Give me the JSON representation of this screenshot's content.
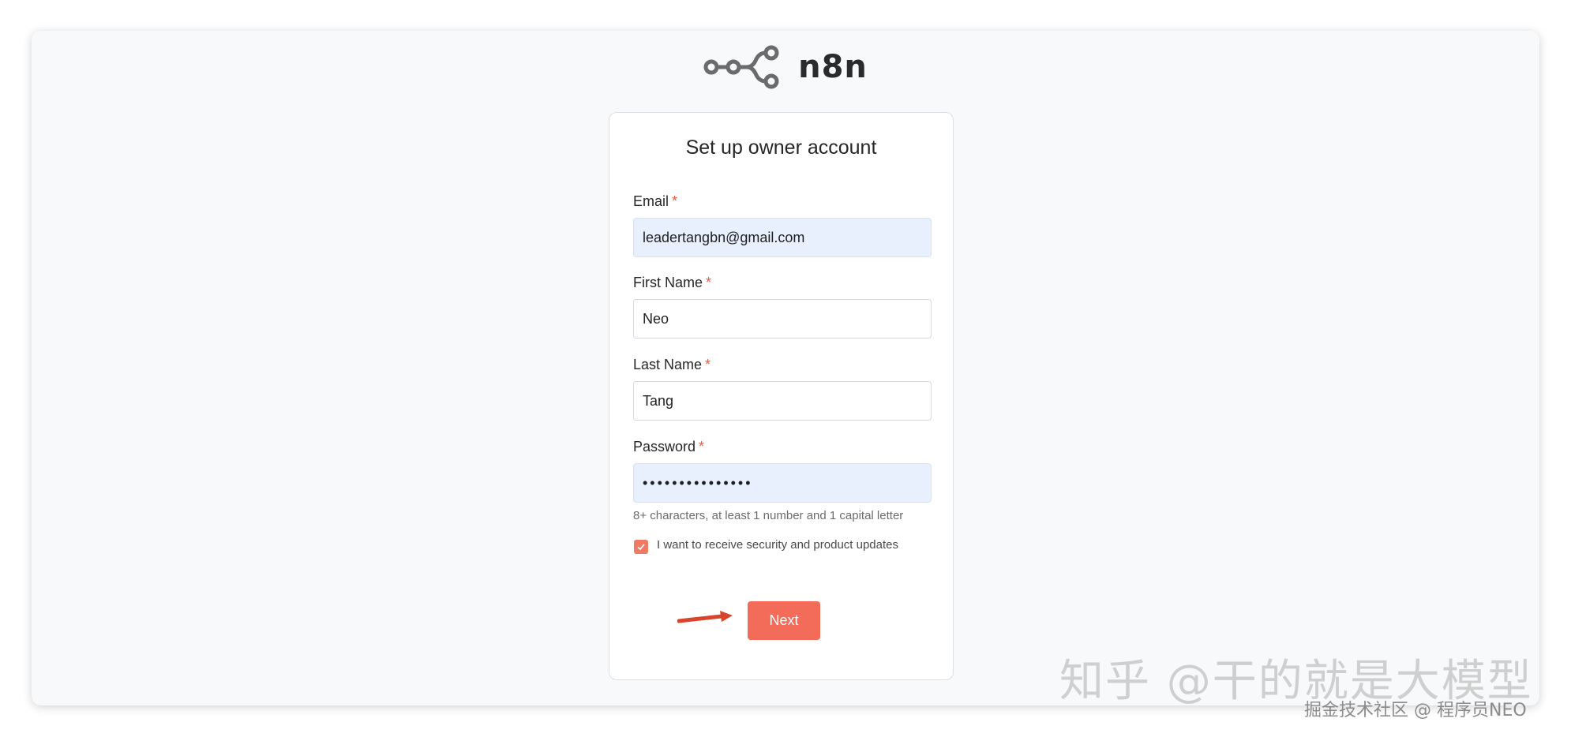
{
  "app": {
    "logo_text": "n8n"
  },
  "form": {
    "title": "Set up owner account",
    "email": {
      "label": "Email",
      "required_mark": "*",
      "value": "leadertangbn@gmail.com"
    },
    "first_name": {
      "label": "First Name",
      "required_mark": "*",
      "value": "Neo"
    },
    "last_name": {
      "label": "Last Name",
      "required_mark": "*",
      "value": "Tang"
    },
    "password": {
      "label": "Password",
      "required_mark": "*",
      "value": "•••••••••••••••"
    },
    "password_hint": "8+ characters, at least 1 number and 1 capital letter",
    "updates_checkbox": {
      "label": "I want to receive security and product updates",
      "checked": true
    },
    "submit_label": "Next"
  },
  "watermark": {
    "primary": "知乎 @干的就是大模型",
    "secondary": "掘金技术社区 @ 程序员NEO"
  },
  "colors": {
    "accent": "#f36c59",
    "required": "#e8573f",
    "autofill_bg": "#e8f0fe",
    "annotation_arrow": "#d9442c"
  },
  "icons": {
    "logo": "n8n-logo-icon",
    "checkbox_check": "checkmark-icon",
    "annotation": "red-arrow-icon"
  }
}
